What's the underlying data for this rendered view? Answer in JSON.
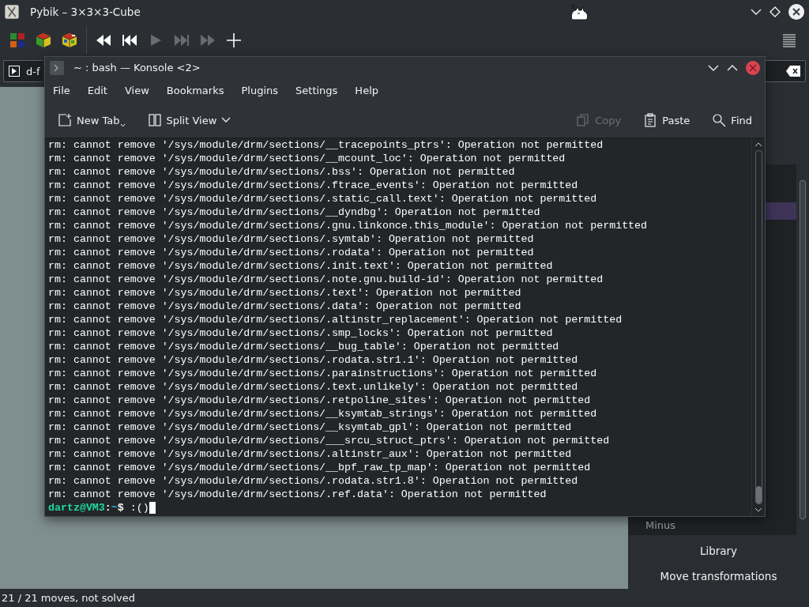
{
  "window": {
    "title": "Pybik – 3×3×3-Cube"
  },
  "toolbar": [
    {
      "kind": "cube-colors",
      "disabled": false
    },
    {
      "kind": "cube-solid",
      "disabled": false
    },
    {
      "kind": "cube-scrambled",
      "disabled": false
    },
    {
      "kind": "rewind",
      "disabled": false
    },
    {
      "kind": "previous",
      "disabled": false
    },
    {
      "kind": "play",
      "disabled": true
    },
    {
      "kind": "next",
      "disabled": true
    },
    {
      "kind": "forward",
      "disabled": true
    },
    {
      "kind": "add",
      "disabled": false
    }
  ],
  "move_field": {
    "value": "d-f"
  },
  "side_list": [
    {
      "selected": true
    },
    {
      "label": "Minus",
      "selected": false
    }
  ],
  "side_buttons": [
    "Library",
    "Move transformations"
  ],
  "status_bar": "21 / 21 moves, not solved",
  "konsole": {
    "title": "~ : bash — Konsole <2>",
    "menu": [
      "File",
      "Edit",
      "View",
      "Bookmarks",
      "Plugins",
      "Settings",
      "Help"
    ],
    "toolbar": [
      {
        "kind": "new-tab",
        "label": "New Tab",
        "disabled": false
      },
      {
        "kind": "split-view",
        "label": "Split View",
        "disabled": false
      },
      {
        "kind": "copy",
        "label": "Copy",
        "disabled": true
      },
      {
        "kind": "paste",
        "label": "Paste",
        "disabled": false
      },
      {
        "kind": "find",
        "label": "Find",
        "disabled": false
      }
    ],
    "lines": [
      "rm: cannot remove '/sys/module/drm/sections/__tracepoints_ptrs': Operation not permitted",
      "rm: cannot remove '/sys/module/drm/sections/__mcount_loc': Operation not permitted",
      "rm: cannot remove '/sys/module/drm/sections/.bss': Operation not permitted",
      "rm: cannot remove '/sys/module/drm/sections/.ftrace_events': Operation not permitted",
      "rm: cannot remove '/sys/module/drm/sections/.static_call.text': Operation not permitted",
      "rm: cannot remove '/sys/module/drm/sections/__dyndbg': Operation not permitted",
      "rm: cannot remove '/sys/module/drm/sections/.gnu.linkonce.this_module': Operation not permitted",
      "rm: cannot remove '/sys/module/drm/sections/.symtab': Operation not permitted",
      "rm: cannot remove '/sys/module/drm/sections/.rodata': Operation not permitted",
      "rm: cannot remove '/sys/module/drm/sections/.init.text': Operation not permitted",
      "rm: cannot remove '/sys/module/drm/sections/.note.gnu.build-id': Operation not permitted",
      "rm: cannot remove '/sys/module/drm/sections/.text': Operation not permitted",
      "rm: cannot remove '/sys/module/drm/sections/.data': Operation not permitted",
      "rm: cannot remove '/sys/module/drm/sections/.altinstr_replacement': Operation not permitted",
      "rm: cannot remove '/sys/module/drm/sections/.smp_locks': Operation not permitted",
      "rm: cannot remove '/sys/module/drm/sections/__bug_table': Operation not permitted",
      "rm: cannot remove '/sys/module/drm/sections/.rodata.str1.1': Operation not permitted",
      "rm: cannot remove '/sys/module/drm/sections/.parainstructions': Operation not permitted",
      "rm: cannot remove '/sys/module/drm/sections/.text.unlikely': Operation not permitted",
      "rm: cannot remove '/sys/module/drm/sections/.retpoline_sites': Operation not permitted",
      "rm: cannot remove '/sys/module/drm/sections/__ksymtab_strings': Operation not permitted",
      "rm: cannot remove '/sys/module/drm/sections/__ksymtab_gpl': Operation not permitted",
      "rm: cannot remove '/sys/module/drm/sections/___srcu_struct_ptrs': Operation not permitted",
      "rm: cannot remove '/sys/module/drm/sections/.altinstr_aux': Operation not permitted",
      "rm: cannot remove '/sys/module/drm/sections/__bpf_raw_tp_map': Operation not permitted",
      "rm: cannot remove '/sys/module/drm/sections/.rodata.str1.8': Operation not permitted",
      "rm: cannot remove '/sys/module/drm/sections/.ref.data': Operation not permitted"
    ],
    "prompt": {
      "user": "dartz@VM3",
      "sep": ":",
      "path": "~",
      "sign": "$",
      "command": ":()"
    }
  }
}
